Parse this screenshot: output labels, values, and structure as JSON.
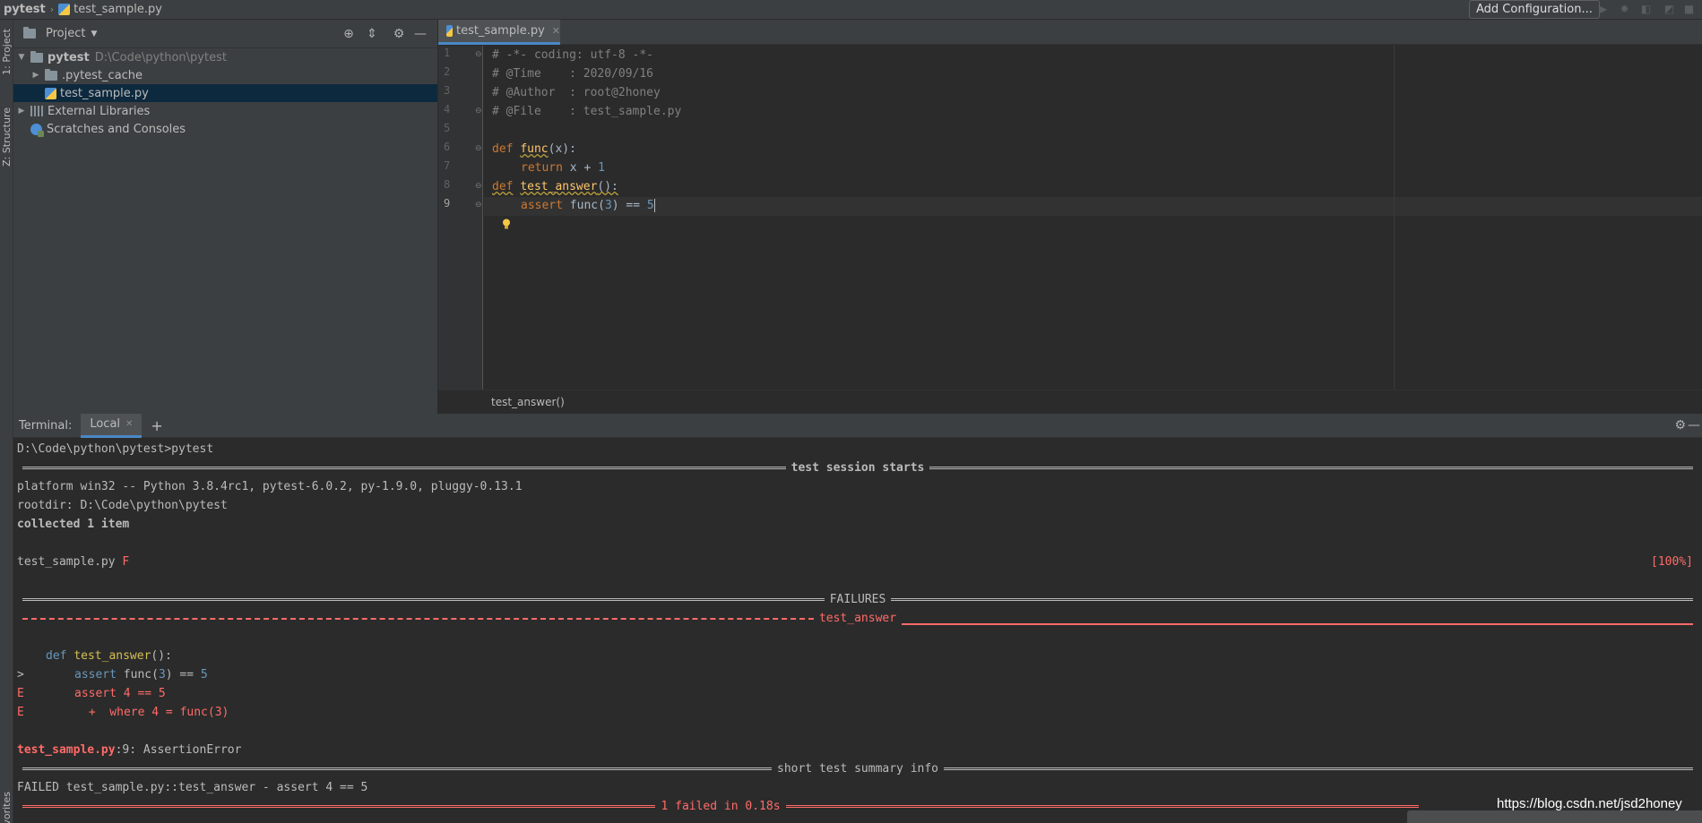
{
  "navbar": {
    "project": "pytest",
    "file": "test_sample.py",
    "add_configuration": "Add Configuration..."
  },
  "left_strip": {
    "project_tab": "1: Project",
    "structure_tab": "Z: Structure",
    "favorites_tab": "avorites"
  },
  "project_panel": {
    "title": "Project",
    "tree": {
      "root_label": "pytest",
      "root_path": "D:\\Code\\python\\pytest",
      "cache_folder": ".pytest_cache",
      "file": "test_sample.py",
      "external_libraries": "External Libraries",
      "scratches": "Scratches and Consoles"
    }
  },
  "editor": {
    "tab_label": "test_sample.py",
    "line_numbers": [
      "1",
      "2",
      "3",
      "4",
      "5",
      "6",
      "7",
      "8",
      "9"
    ],
    "lines": {
      "l1": "# -*- coding: utf-8 -*-",
      "l2": "# @Time    : 2020/09/16",
      "l3": "# @Author  : root@2honey",
      "l4": "# @File    : test_sample.py",
      "l6_kw": "def",
      "l6_fn": "func",
      "l6_rest": "(x):",
      "l7_kw": "return",
      "l7_mid": " x + ",
      "l7_num": "1",
      "l8_kw": "def",
      "l8_fn": "test_answer",
      "l8_rest": "():",
      "l9_kw": "assert",
      "l9_a": " func(",
      "l9_n1": "3",
      "l9_b": ") == ",
      "l9_n2": "5"
    },
    "breadcrumb": "test_answer()"
  },
  "terminal": {
    "title": "Terminal:",
    "tab_label": "Local",
    "prompt": "D:\\Code\\python\\pytest>pytest",
    "session_start": "test session starts",
    "platform": "platform win32 -- Python 3.8.4rc1, pytest-6.0.2, py-1.9.0, pluggy-0.13.1",
    "rootdir": "rootdir: D:\\Code\\python\\pytest",
    "collected": "collected 1 item",
    "result_file": "test_sample.py ",
    "result_mark": "F",
    "percent": "[100%]",
    "failures": "FAILURES",
    "test_name": "test_answer",
    "tb_def_kw": "def",
    "tb_def_fn": "test_answer",
    "tb_def_rest": "():",
    "tb_arrow": ">",
    "tb_assert_kw": "assert",
    "tb_assert_a": " func(",
    "tb_assert_n1": "3",
    "tb_assert_b": ") == ",
    "tb_assert_n2": "5",
    "tb_e1_prefix": "E",
    "tb_e1": "assert 4 == 5",
    "tb_e2_prefix": "E",
    "tb_e2": " +  where 4 = func(3)",
    "error_loc_file": "test_sample.py",
    "error_loc_rest": ":9: AssertionError",
    "summary_title": "short test summary info",
    "failed_line": "FAILED test_sample.py::test_answer - assert 4 == 5",
    "final": "1 failed in 0.18s"
  },
  "watermark": "https://blog.csdn.net/jsd2honey",
  "colors": {
    "background": "#2b2b2b",
    "panel": "#3c3f41",
    "selection": "#0d293e",
    "keyword": "#cc7832",
    "function": "#ffc66d",
    "number": "#6897bb",
    "comment": "#808080",
    "error": "#ff6b68",
    "accent": "#4a88c7"
  }
}
